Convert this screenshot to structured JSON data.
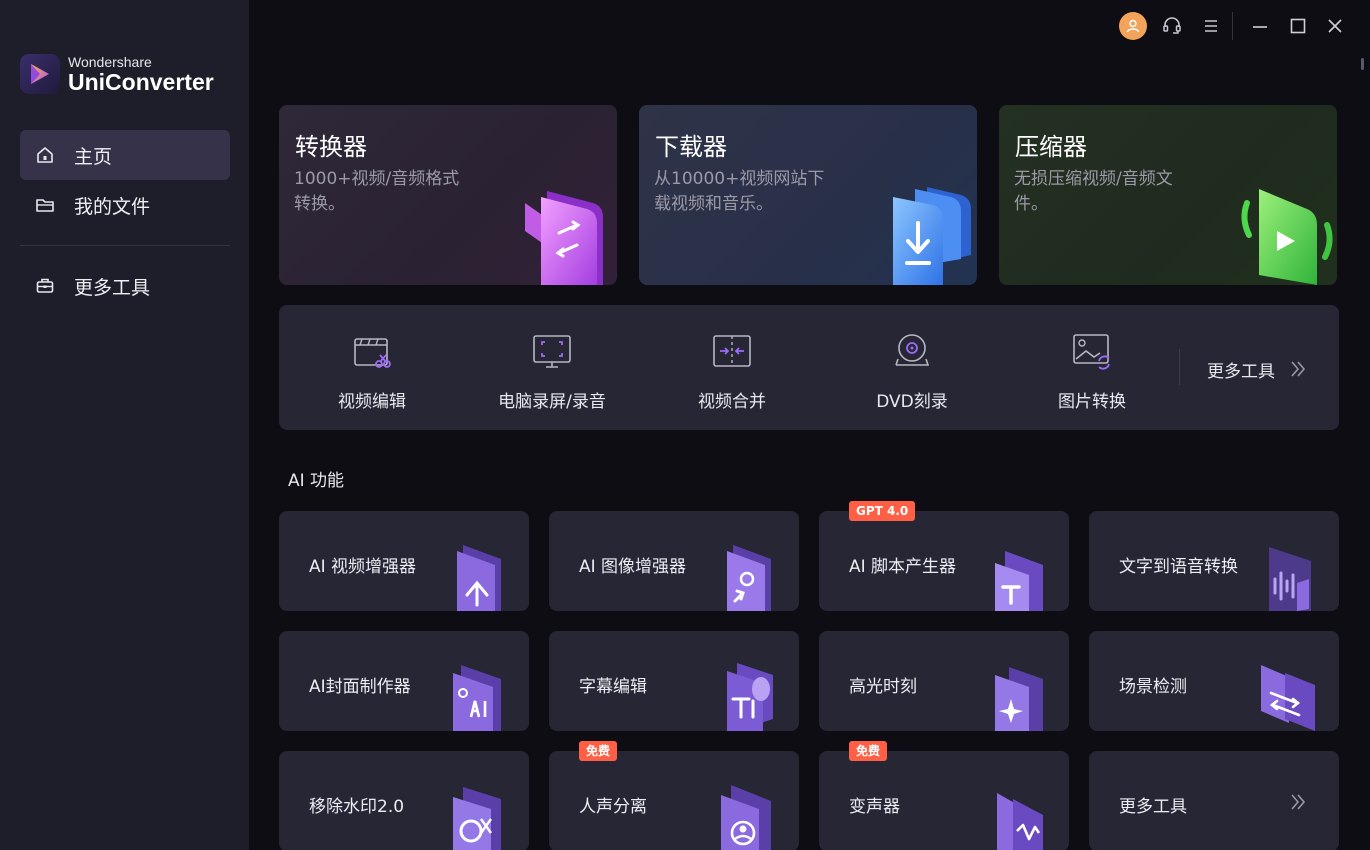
{
  "app": {
    "brand_top": "Wondershare",
    "brand_main": "UniConverter"
  },
  "sidebar": {
    "items": [
      {
        "label": "主页",
        "icon": "home-icon",
        "active": true
      },
      {
        "label": "我的文件",
        "icon": "folder-icon",
        "active": false
      },
      {
        "label": "更多工具",
        "icon": "toolbox-icon",
        "active": false
      }
    ]
  },
  "titlebar": {
    "icons": [
      "user-avatar-icon",
      "headset-icon",
      "menu-icon",
      "minimize-icon",
      "maximize-icon",
      "close-icon"
    ]
  },
  "main_cards": [
    {
      "title": "转换器",
      "desc": "1000+视频/音频格式转换。",
      "accent": "#c45ce8"
    },
    {
      "title": "下载器",
      "desc": "从10000+视频网站下载视频和音乐。",
      "accent": "#3f8ef0"
    },
    {
      "title": "压缩器",
      "desc": "无损压缩视频/音频文件。",
      "accent": "#4fd34a"
    }
  ],
  "tools": {
    "items": [
      {
        "label": "视频编辑",
        "icon": "video-edit-icon"
      },
      {
        "label": "电脑录屏/录音",
        "icon": "screen-record-icon"
      },
      {
        "label": "视频合并",
        "icon": "merge-icon"
      },
      {
        "label": "DVD刻录",
        "icon": "dvd-icon"
      },
      {
        "label": "图片转换",
        "icon": "image-convert-icon"
      }
    ],
    "more_label": "更多工具"
  },
  "ai_section": {
    "title": "AI 功能",
    "cards": [
      {
        "label": "AI 视频增强器",
        "badge": ""
      },
      {
        "label": "AI 图像增强器",
        "badge": ""
      },
      {
        "label": "AI 脚本产生器",
        "badge": "GPT 4.0"
      },
      {
        "label": "文字到语音转换",
        "badge": ""
      },
      {
        "label": "AI封面制作器",
        "badge": ""
      },
      {
        "label": "字幕编辑",
        "badge": ""
      },
      {
        "label": "高光时刻",
        "badge": ""
      },
      {
        "label": "场景检测",
        "badge": ""
      },
      {
        "label": "移除水印2.0",
        "badge": ""
      },
      {
        "label": "人声分离",
        "badge": "免费"
      },
      {
        "label": "变声器",
        "badge": "免费"
      },
      {
        "label": "更多工具",
        "badge": ""
      }
    ]
  },
  "colors": {
    "sidebar_bg": "#1e1d2a",
    "main_bg": "#0e0d14",
    "card_bg": "#272634",
    "active_item": "#35324a",
    "badge": "#ff5f45",
    "avatar": "#f3a35a"
  }
}
